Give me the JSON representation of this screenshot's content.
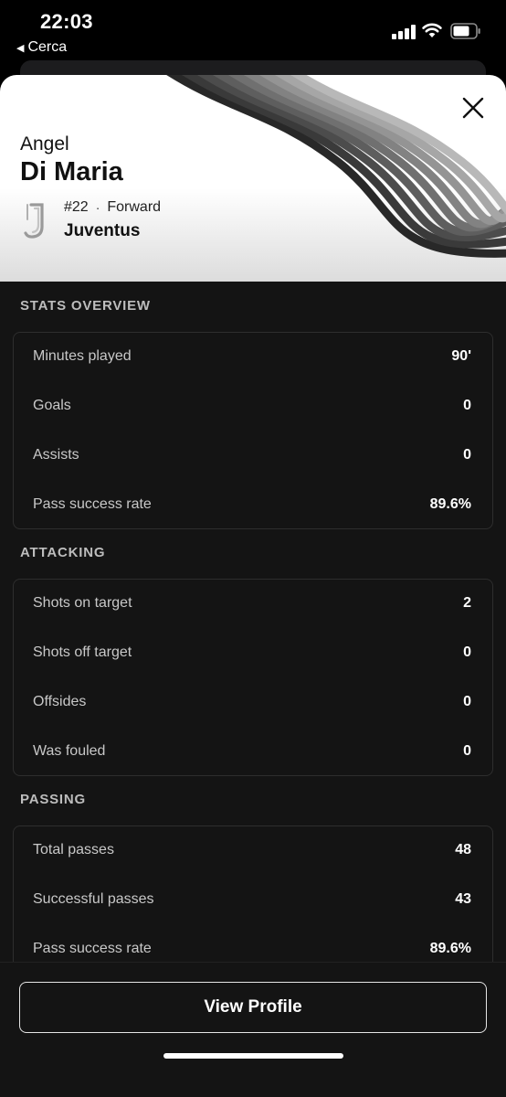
{
  "status_bar": {
    "time": "22:03",
    "back_app": "Cerca",
    "icons": [
      "signal-icon",
      "wifi-icon",
      "battery-icon"
    ]
  },
  "player": {
    "first_name": "Angel",
    "last_name": "Di Maria",
    "number": "#22",
    "separator": "·",
    "position": "Forward",
    "team": "Juventus",
    "club_logo_icon": "juventus-logo-icon"
  },
  "sections": [
    {
      "title": "STATS OVERVIEW",
      "rows": [
        {
          "label": "Minutes played",
          "value": "90'"
        },
        {
          "label": "Goals",
          "value": "0"
        },
        {
          "label": "Assists",
          "value": "0"
        },
        {
          "label": "Pass success rate",
          "value": "89.6%"
        }
      ]
    },
    {
      "title": "ATTACKING",
      "rows": [
        {
          "label": "Shots on target",
          "value": "2"
        },
        {
          "label": "Shots off target",
          "value": "0"
        },
        {
          "label": "Offsides",
          "value": "0"
        },
        {
          "label": "Was fouled",
          "value": "0"
        }
      ]
    },
    {
      "title": "PASSING",
      "rows": [
        {
          "label": "Total passes",
          "value": "48"
        },
        {
          "label": "Successful passes",
          "value": "43"
        },
        {
          "label": "Pass success rate",
          "value": "89.6%"
        }
      ]
    }
  ],
  "actions": {
    "view_profile_label": "View Profile",
    "close_icon": "close-icon"
  },
  "colors": {
    "background": "#141414",
    "header_bg": "#ffffff",
    "card_border": "#2e2e2e",
    "label": "#c8c8c8",
    "value": "#ffffff"
  }
}
